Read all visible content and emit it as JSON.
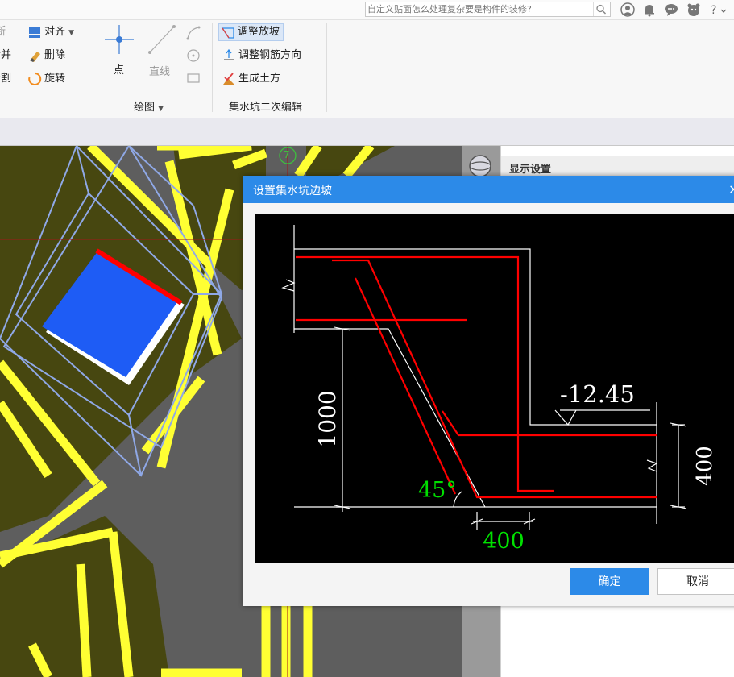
{
  "search": {
    "placeholder": "自定义贴面怎么处理复杂要是构件的装修?"
  },
  "ribbon": {
    "modify": {
      "break_label": "断",
      "merge_label": "合并",
      "split_label": "分割",
      "align_label": "对齐",
      "delete_label": "删除",
      "rotate_label": "旋转"
    },
    "draw": {
      "point_label": "点",
      "line_label": "直线",
      "group_label": "绘图"
    },
    "pit": {
      "adjust_slope_label": "调整放坡",
      "adjust_rebar_label": "调整钢筋方向",
      "gen_earthwork_label": "生成土方",
      "group_label": "集水坑二次编辑"
    }
  },
  "canvas": {
    "axis_label": "7"
  },
  "right_panel": {
    "title": "显示设置"
  },
  "dialog": {
    "title": "设置集水坑边坡",
    "close": "×",
    "ok_label": "确定",
    "cancel_label": "取消",
    "diagram": {
      "elevation": "-12.45",
      "depth": "1000",
      "thickness": "400",
      "angle": "45°",
      "width": "400"
    }
  },
  "colors": {
    "accent": "#2c8ae8",
    "pit_blue": "#1e5cf5",
    "yellow": "#ffff33",
    "olive": "#4a4a00",
    "rebar_red": "#ff0000",
    "dim_green": "#00e000"
  }
}
